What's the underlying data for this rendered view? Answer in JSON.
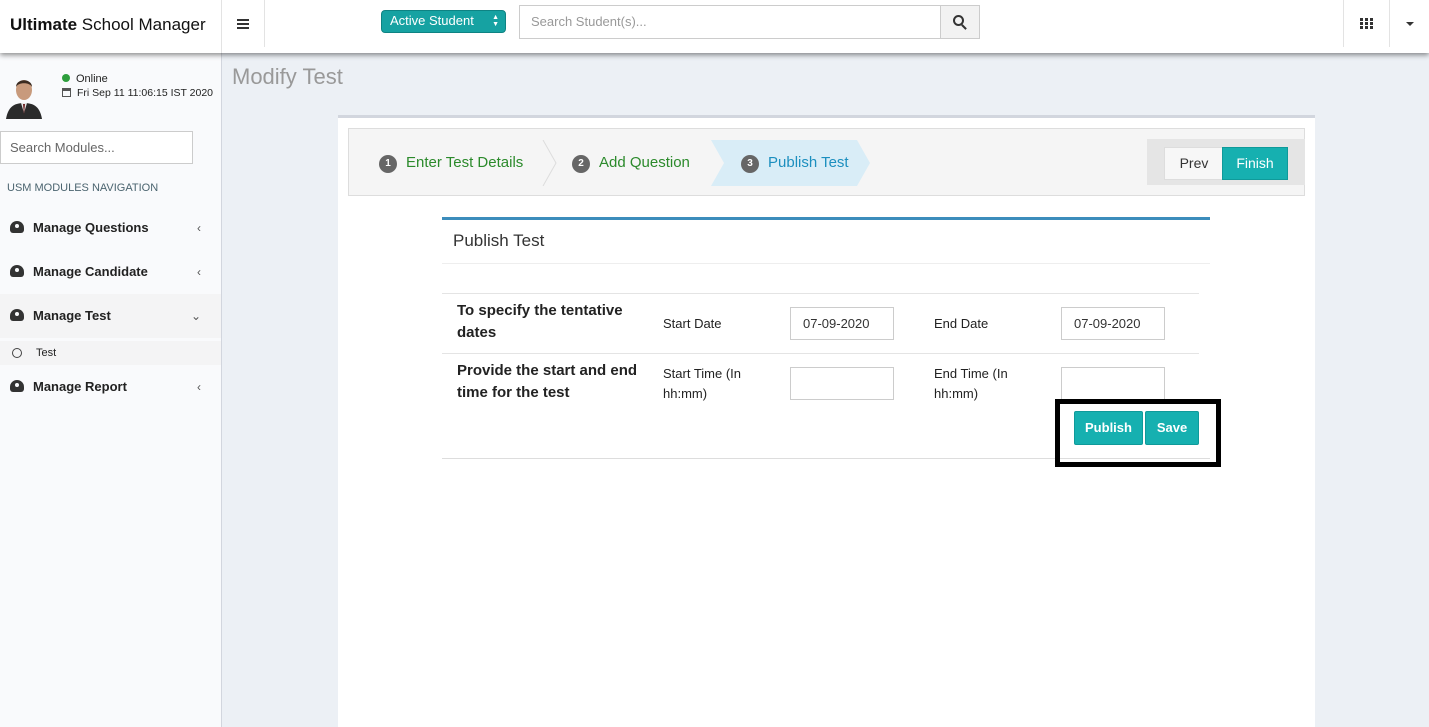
{
  "header": {
    "brand_bold": "Ultimate",
    "brand_rest": " School Manager",
    "student_filter": "Active Student",
    "search_placeholder": "Search Student(s)..."
  },
  "sidebar": {
    "status": "Online",
    "datetime": "Fri Sep 11 11:06:15 IST 2020",
    "module_search_placeholder": "Search Modules...",
    "nav_header": "USM MODULES NAVIGATION",
    "items": [
      {
        "label": "Manage Questions",
        "chevron": "‹"
      },
      {
        "label": "Manage Candidate",
        "chevron": "‹"
      },
      {
        "label": "Manage Test",
        "chevron": "⌄"
      },
      {
        "label": "Manage Report",
        "chevron": "‹"
      }
    ],
    "sub_item": "Test"
  },
  "main": {
    "page_title": "Modify Test",
    "wizard": {
      "steps": [
        {
          "num": "1",
          "label": "Enter Test Details"
        },
        {
          "num": "2",
          "label": "Add Question"
        },
        {
          "num": "3",
          "label": "Publish Test"
        }
      ],
      "prev_label": "Prev",
      "finish_label": "Finish"
    },
    "publish": {
      "title": "Publish Test",
      "row1_question": "To specify the tentative dates",
      "start_date_label": "Start Date",
      "start_date_value": "07-09-2020",
      "end_date_label": "End Date",
      "end_date_value": "07-09-2020",
      "row2_question": "Provide the start and end time for the test",
      "start_time_label": "Start Time (In hh:mm)",
      "start_time_value": "",
      "end_time_label": "End Time (In hh:mm)",
      "end_time_value": "",
      "publish_label": "Publish",
      "save_label": "Save"
    }
  },
  "colors": {
    "accent": "#16b0b0",
    "step_done": "#2b8a2b",
    "step_current": "#1c8fbf",
    "box_top": "#3c8dbc"
  }
}
